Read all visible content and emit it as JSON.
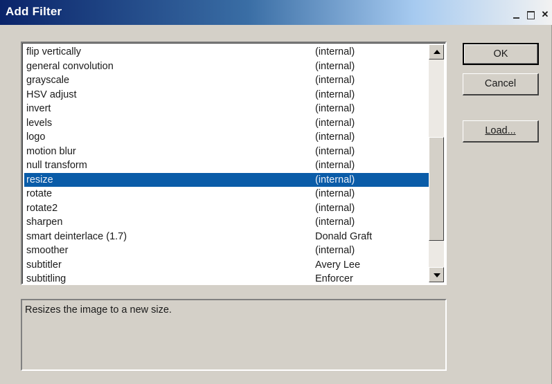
{
  "window": {
    "title": "Add Filter"
  },
  "filters": [
    {
      "name": "flip vertically",
      "author": "(internal)",
      "selected": false
    },
    {
      "name": "general convolution",
      "author": "(internal)",
      "selected": false
    },
    {
      "name": "grayscale",
      "author": "(internal)",
      "selected": false
    },
    {
      "name": "HSV adjust",
      "author": "(internal)",
      "selected": false
    },
    {
      "name": "invert",
      "author": "(internal)",
      "selected": false
    },
    {
      "name": "levels",
      "author": "(internal)",
      "selected": false
    },
    {
      "name": "logo",
      "author": "(internal)",
      "selected": false
    },
    {
      "name": "motion blur",
      "author": "(internal)",
      "selected": false
    },
    {
      "name": "null transform",
      "author": "(internal)",
      "selected": false
    },
    {
      "name": "resize",
      "author": "(internal)",
      "selected": true
    },
    {
      "name": "rotate",
      "author": "(internal)",
      "selected": false
    },
    {
      "name": "rotate2",
      "author": "(internal)",
      "selected": false
    },
    {
      "name": "sharpen",
      "author": "(internal)",
      "selected": false
    },
    {
      "name": "smart deinterlace (1.7)",
      "author": "Donald Graft",
      "selected": false
    },
    {
      "name": "smoother",
      "author": "(internal)",
      "selected": false
    },
    {
      "name": "subtitler",
      "author": "Avery Lee",
      "selected": false
    },
    {
      "name": "subtitling",
      "author": "Enforcer",
      "selected": false
    }
  ],
  "description": "Resizes the image to a new size.",
  "buttons": {
    "ok": "OK",
    "cancel": "Cancel",
    "load": "Load..."
  },
  "colors": {
    "selection": "#0a5ca8",
    "dialog_face": "#d4d0c8",
    "title_gradient_start": "#0a246a"
  }
}
